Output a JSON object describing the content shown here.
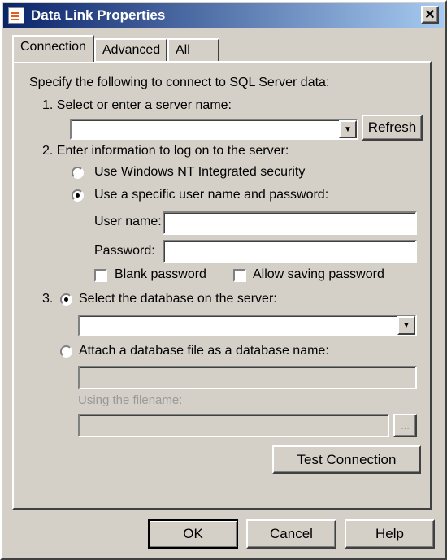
{
  "window": {
    "title": "Data Link Properties",
    "close": "✕"
  },
  "tabs": [
    {
      "label": "Connection",
      "active": true
    },
    {
      "label": "Advanced"
    },
    {
      "label": "All"
    }
  ],
  "connection": {
    "intro": "Specify the following to connect to SQL Server data:",
    "step1": "1. Select or enter a server name:",
    "server_value": "",
    "refresh": "Refresh",
    "step2": "2. Enter information to log on to the server:",
    "radio_nt": "Use Windows NT Integrated security",
    "radio_specific": "Use a specific user name and password:",
    "username_label": "User name:",
    "username_value": "",
    "password_label": "Password:",
    "password_value": "",
    "blank_password": "Blank password",
    "allow_saving": "Allow saving password",
    "step3": "3.",
    "radio_select_db": "Select the database on the server:",
    "database_value": "",
    "radio_attach": "Attach a database file as a database name:",
    "attach_value": "",
    "filename_label": "Using the filename:",
    "filename_value": "",
    "browse": "...",
    "test_connection": "Test Connection",
    "selected_auth": "specific",
    "selected_db_option": "select"
  },
  "footer": {
    "ok": "OK",
    "cancel": "Cancel",
    "help": "Help"
  }
}
